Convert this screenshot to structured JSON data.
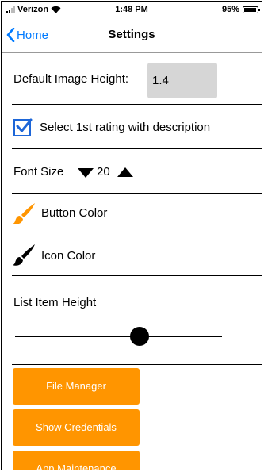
{
  "status_bar": {
    "carrier": "Verizon",
    "time": "1:48 PM",
    "battery_text": "95%",
    "battery_level": 0.95
  },
  "nav": {
    "back_label": "Home",
    "title": "Settings"
  },
  "settings": {
    "image_height_label": "Default Image Height:",
    "image_height_value": "1.4",
    "rating_checkbox_label": "Select 1st rating with description",
    "rating_checkbox_checked": true,
    "font_size_label": "Font Size",
    "font_size_value": "20",
    "button_color_label": "Button Color",
    "icon_color_label": "Icon Color",
    "list_item_height_label": "List Item Height",
    "list_item_height_slider_value": 0.6
  },
  "colors": {
    "accent": "#007aff",
    "button_color": "#ff9500",
    "icon_color": "#000000",
    "checkbox": "#1d66d8",
    "input_bg": "#d6d6d6"
  },
  "buttons": {
    "file_manager": "File Manager",
    "show_credentials": "Show Credentials",
    "app_maintenance": "App Maintenance"
  }
}
